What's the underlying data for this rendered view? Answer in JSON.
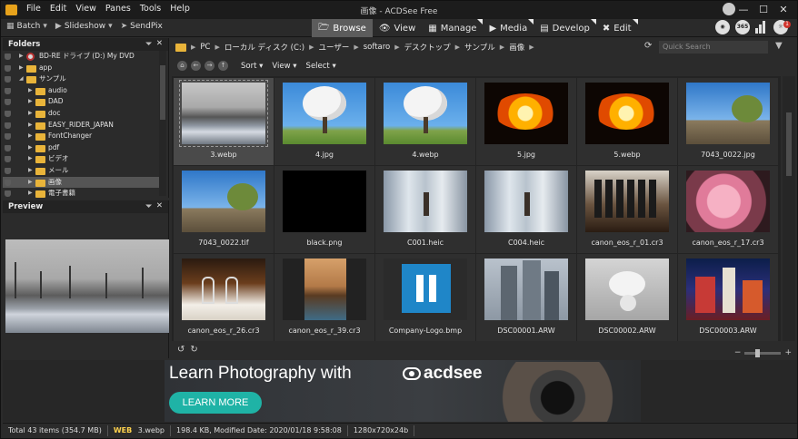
{
  "window": {
    "title": "画像 - ACDSee Free",
    "controls": [
      "—",
      "☐",
      "✕"
    ]
  },
  "menu": [
    "File",
    "Edit",
    "View",
    "Panes",
    "Tools",
    "Help"
  ],
  "toolbar": {
    "batch": "Batch",
    "slideshow": "Slideshow",
    "sendpix": "SendPix",
    "modes": [
      {
        "label": "Browse",
        "icon": "folder-icon",
        "active": true
      },
      {
        "label": "View",
        "icon": "eye-icon",
        "active": false
      },
      {
        "label": "Manage",
        "icon": "grid-icon",
        "active": false
      },
      {
        "label": "Media",
        "icon": "media-icon",
        "active": false
      },
      {
        "label": "Develop",
        "icon": "develop-icon",
        "active": false
      },
      {
        "label": "Edit",
        "icon": "edit-tools-icon",
        "active": false
      }
    ],
    "badge_365": "365",
    "notification_count": "1"
  },
  "folders_panel": {
    "title": "Folders",
    "items": [
      {
        "label": "BD-RE ドライブ (D:) My DVD",
        "depth": 1,
        "type": "dvd"
      },
      {
        "label": "app",
        "depth": 1,
        "type": "folder"
      },
      {
        "label": "サンプル",
        "depth": 1,
        "type": "folder",
        "expanded": true
      },
      {
        "label": "audio",
        "depth": 2,
        "type": "folder"
      },
      {
        "label": "DAD",
        "depth": 2,
        "type": "folder"
      },
      {
        "label": "doc",
        "depth": 2,
        "type": "folder"
      },
      {
        "label": "EASY_RIDER_JAPAN",
        "depth": 2,
        "type": "folder"
      },
      {
        "label": "FontChanger",
        "depth": 2,
        "type": "folder"
      },
      {
        "label": "pdf",
        "depth": 2,
        "type": "folder"
      },
      {
        "label": "ビデオ",
        "depth": 2,
        "type": "folder"
      },
      {
        "label": "メール",
        "depth": 2,
        "type": "folder"
      },
      {
        "label": "画像",
        "depth": 2,
        "type": "folder",
        "selected": true
      },
      {
        "label": "電子書籍",
        "depth": 2,
        "type": "folder"
      }
    ]
  },
  "preview_panel": {
    "title": "Preview"
  },
  "address": {
    "crumbs": [
      "PC",
      "ローカル ディスク (C:)",
      "ユーザー",
      "softaro",
      "デスクトップ",
      "サンプル",
      "画像"
    ],
    "search_placeholder": "Quick Search"
  },
  "nav": {
    "sort": "Sort",
    "view": "View",
    "select": "Select"
  },
  "files": [
    {
      "name": "3.webp",
      "thumb": "snow",
      "selected": true
    },
    {
      "name": "4.jpg",
      "thumb": "tree"
    },
    {
      "name": "4.webp",
      "thumb": "tree"
    },
    {
      "name": "5.jpg",
      "thumb": "fire"
    },
    {
      "name": "5.webp",
      "thumb": "fire"
    },
    {
      "name": "7043_0022.jpg",
      "thumb": "rock"
    },
    {
      "name": "7043_0022.tif",
      "thumb": "rock"
    },
    {
      "name": "black.png",
      "thumb": "black"
    },
    {
      "name": "C001.heic",
      "thumb": "hall"
    },
    {
      "name": "C004.heic",
      "thumb": "hall"
    },
    {
      "name": "canon_eos_r_01.cr3",
      "thumb": "bottles"
    },
    {
      "name": "canon_eos_r_17.cr3",
      "thumb": "rose"
    },
    {
      "name": "canon_eos_r_26.cr3",
      "thumb": "glasses"
    },
    {
      "name": "canon_eos_r_39.cr3",
      "thumb": "man"
    },
    {
      "name": "Company-Logo.bmp",
      "thumb": "logo"
    },
    {
      "name": "DSC00001.ARW",
      "thumb": "towers"
    },
    {
      "name": "DSC00002.ARW",
      "thumb": "gulls"
    },
    {
      "name": "DSC00003.ARW",
      "thumb": "night"
    }
  ],
  "ad": {
    "headline": "Learn Photography with",
    "brand": "acdsee",
    "button": "LEARN MORE"
  },
  "status": {
    "total": "Total 43 items  (354.7 MB)",
    "type": "WEB",
    "filename": "3.webp",
    "info": "198.4 KB, Modified Date: 2020/01/18 9:58:08",
    "dimensions": "1280x720x24b"
  }
}
